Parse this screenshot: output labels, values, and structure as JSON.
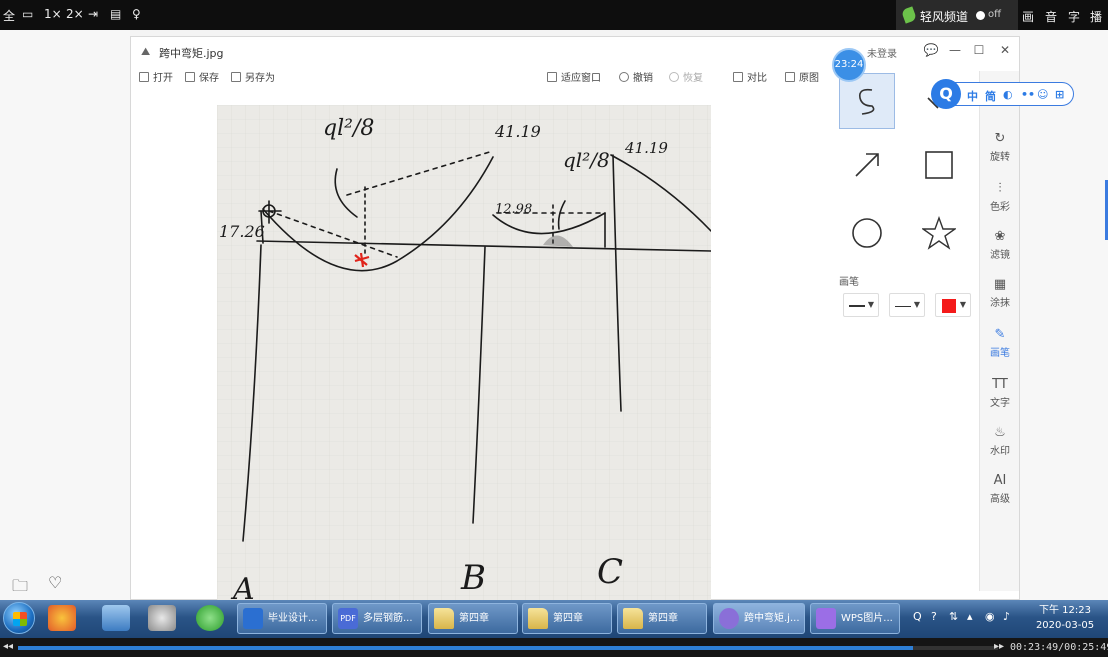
{
  "topbar": {
    "items": [
      "全",
      "1×",
      "2×"
    ],
    "brand_label": "轻风频道",
    "toggle_state": "off",
    "right_items": [
      "画",
      "音",
      "字",
      "播"
    ]
  },
  "window": {
    "title": "跨中弯矩.jpg",
    "login": "未登录",
    "toolbar": {
      "open": "打开",
      "save": "保存",
      "save_as": "另存为",
      "fit_window": "适应窗口",
      "undo": "撤销",
      "redo": "恢复",
      "compare": "对比",
      "original": "原图"
    },
    "pen_panel": {
      "label": "画笔",
      "color": "#f41a1a"
    },
    "sidebar": [
      "旋转",
      "色彩",
      "滤镜",
      "涂抹",
      "画笔",
      "文字",
      "水印",
      "高级"
    ],
    "sidebar_icons": [
      "AI",
      "TT"
    ],
    "active_tool": "画笔"
  },
  "photo": {
    "labels": {
      "top_left_formula": "ql²/8",
      "right_formula": "ql²/8",
      "left_value": "17.26",
      "value_b": "41.19",
      "value_c": "41.19",
      "value_mid": "12.98",
      "support_a": "A",
      "support_b": "B",
      "support_c": "C"
    }
  },
  "overlay": {
    "timer": "23:24",
    "qbar_items": [
      "中",
      "简",
      "◐",
      "••",
      "☺",
      "⊞"
    ],
    "qbar_logo": "Q"
  },
  "taskbar": {
    "tasks": [
      {
        "label": "毕业设计...",
        "color": "#2b6fd1"
      },
      {
        "label": "多层钢筋...",
        "color": "#4a6bd6"
      },
      {
        "label": "第四章",
        "color": "folder"
      },
      {
        "label": "第四章",
        "color": "folder"
      },
      {
        "label": "第四章",
        "color": "folder"
      },
      {
        "label": "跨中弯矩.j...",
        "color": "#8a6fd8"
      },
      {
        "label": "WPS图片...",
        "color": "#9b6ee6"
      }
    ],
    "pdf_text": "PDF",
    "clock_time": "下午 12:23",
    "clock_date": "2020-03-05"
  },
  "player": {
    "progress": 0.913,
    "time": "00:23:49/00:25:49"
  }
}
